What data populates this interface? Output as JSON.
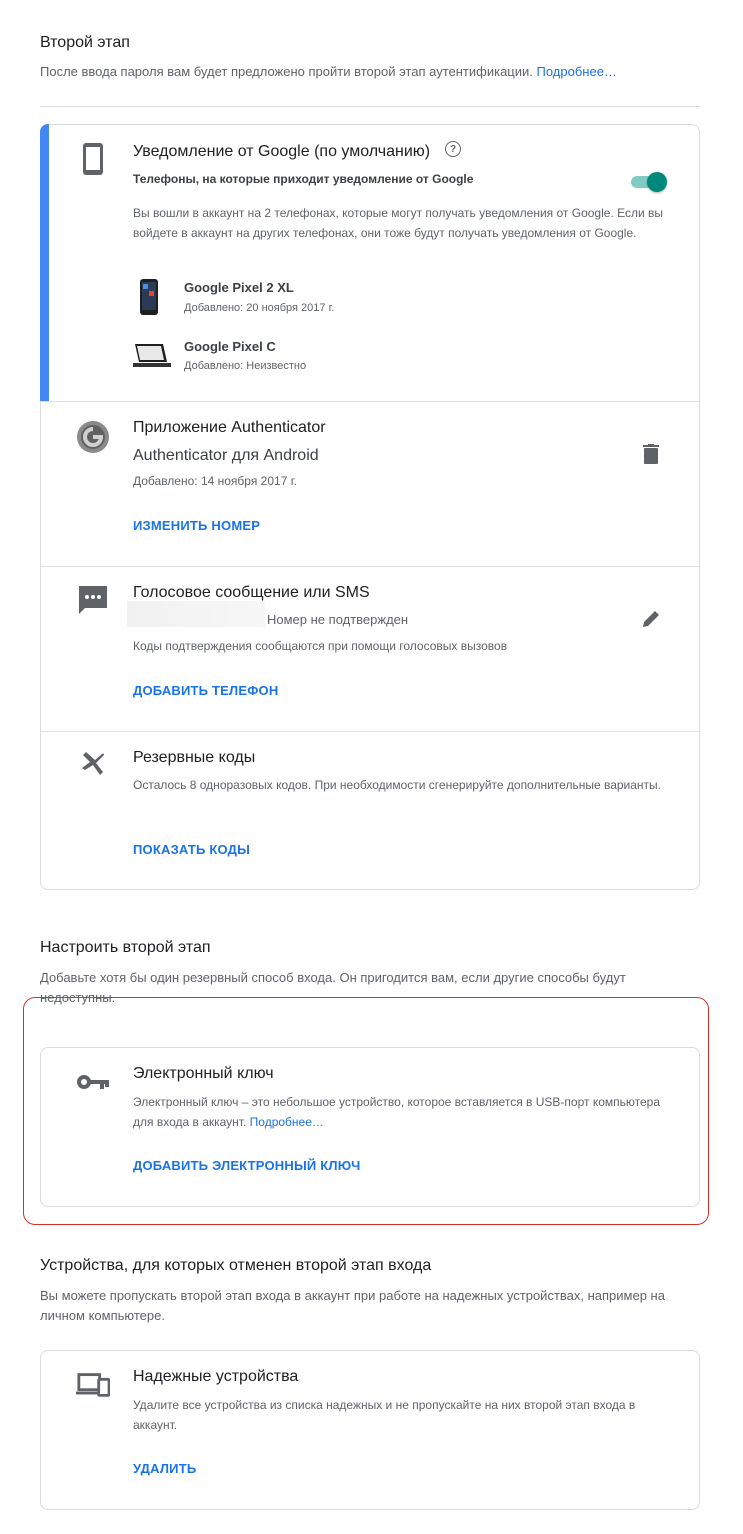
{
  "second_step": {
    "title": "Второй этап",
    "desc": "После ввода пароля вам будет предложено пройти второй этап аутентификации.",
    "more_link": "Подробнее…"
  },
  "google_prompt": {
    "title": "Уведомление от Google (по умолчанию)",
    "help_icon": "?",
    "phones_label": "Телефоны, на которые приходит уведомление от Google",
    "toggle_on": true,
    "desc": "Вы вошли в аккаунт на 2 телефонах, которые могут получать уведомления от Google. Если вы войдете в аккаунт на других телефонах, они тоже будут получать уведомления от Google.",
    "devices": [
      {
        "name": "Google Pixel 2 XL",
        "added": "Добавлено: 20 ноября 2017 г."
      },
      {
        "name": "Google Pixel C",
        "added": "Добавлено: Неизвестно"
      }
    ]
  },
  "authenticator": {
    "title": "Приложение Authenticator",
    "subtitle": "Authenticator для Android",
    "added": "Добавлено: 14 ноября 2017 г.",
    "action": "ИЗМЕНИТЬ НОМЕР"
  },
  "voice_sms": {
    "title": "Голосовое сообщение или SMS",
    "status": "Номер не подтвержден",
    "desc": "Коды подтверждения сообщаются при помощи голосовых вызовов",
    "action": "ДОБАВИТЬ ТЕЛЕФОН"
  },
  "backup_codes": {
    "title": "Резервные коды",
    "desc": "Осталось 8 одноразовых кодов. При необходимости сгенерируйте дополнительные варианты.",
    "action": "ПОКАЗАТЬ КОДЫ"
  },
  "setup": {
    "title": "Настроить второй этап",
    "desc": "Добавьте хотя бы один резервный способ входа. Он пригодится вам, если другие способы будут недоступны."
  },
  "security_key": {
    "title": "Электронный ключ",
    "desc": "Электронный ключ – это небольшое устройство, которое вставляется в USB-порт компьютера для входа в аккаунт.",
    "more_link": "Подробнее…",
    "action": "ДОБАВИТЬ ЭЛЕКТРОННЫЙ КЛЮЧ"
  },
  "trusted": {
    "title": "Устройства, для которых отменен второй этап входа",
    "desc": "Вы можете пропускать второй этап входа в аккаунт при работе на надежных устройствах, например на личном компьютере.",
    "card_title": "Надежные устройства",
    "card_desc": "Удалите все устройства из списка надежных и не пропускайте на них второй этап входа в аккаунт.",
    "action": "УДАЛИТЬ"
  },
  "colors": {
    "accent": "#4285f4",
    "link": "#1a73e8",
    "toggle": "#00897b",
    "highlight": "#d93025"
  }
}
